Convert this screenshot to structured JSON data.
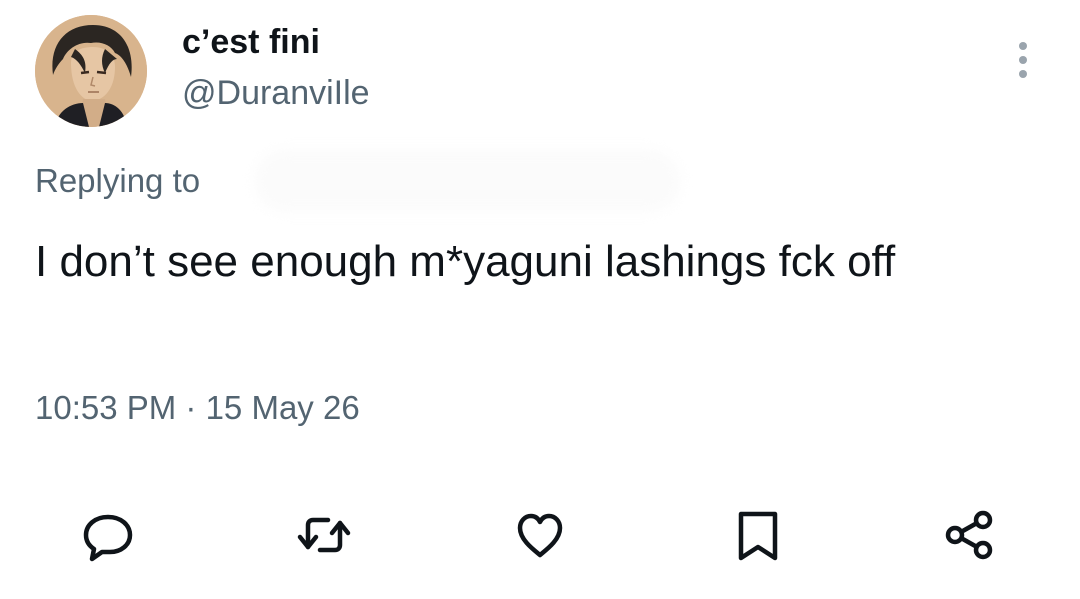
{
  "tweet": {
    "display_name": "c’est fini",
    "handle": "@DuranviIle",
    "replying_to_label": "Replying to",
    "text": "I don’t see enough m*yaguni lashings fck off",
    "timestamp": "10:53 PM · 15 May 26"
  },
  "actions": {
    "reply_icon": "reply-icon",
    "retweet_icon": "retweet-icon",
    "like_icon": "heart-icon",
    "bookmark_icon": "bookmark-icon",
    "share_icon": "share-icon"
  },
  "colors": {
    "text_primary": "#0f1419",
    "text_secondary": "#536471",
    "icon": "#0f1419",
    "background": "#ffffff"
  }
}
